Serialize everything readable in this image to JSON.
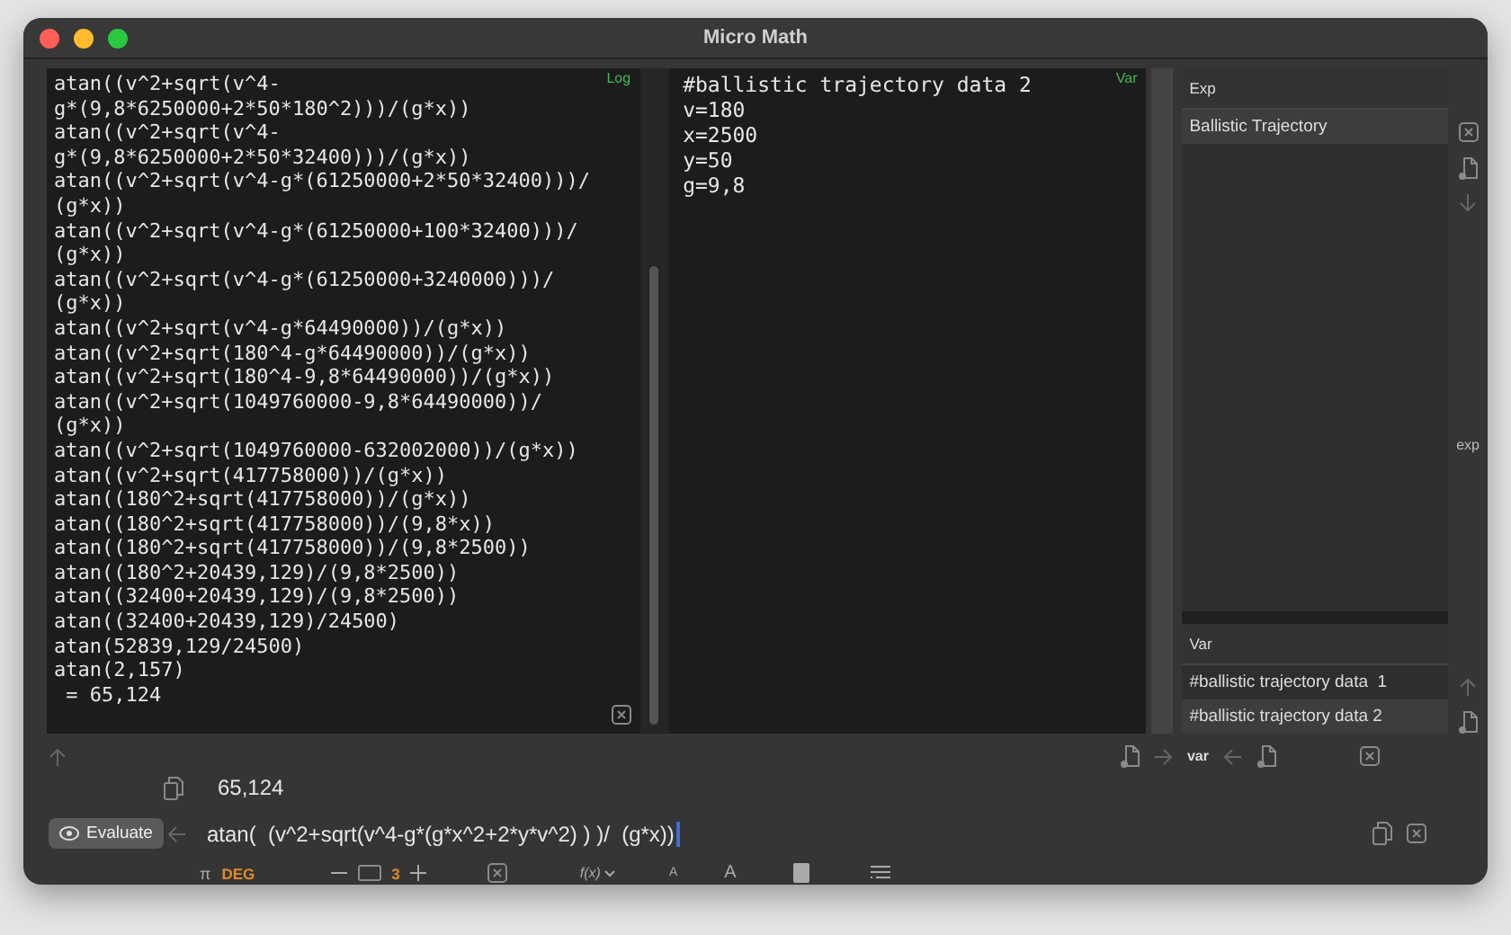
{
  "window": {
    "title": "Micro Math"
  },
  "log": {
    "badge": "Log",
    "lines": [
      "atan((v^2+sqrt(v^4-",
      "g*(9,8*6250000+2*50*180^2)))/(g*x))",
      "atan((v^2+sqrt(v^4-",
      "g*(9,8*6250000+2*50*32400)))/(g*x))",
      "atan((v^2+sqrt(v^4-g*(61250000+2*50*32400)))/",
      "(g*x))",
      "atan((v^2+sqrt(v^4-g*(61250000+100*32400)))/",
      "(g*x))",
      "atan((v^2+sqrt(v^4-g*(61250000+3240000)))/",
      "(g*x))",
      "atan((v^2+sqrt(v^4-g*64490000))/(g*x))",
      "atan((v^2+sqrt(180^4-g*64490000))/(g*x))",
      "atan((v^2+sqrt(180^4-9,8*64490000))/(g*x))",
      "atan((v^2+sqrt(1049760000-9,8*64490000))/",
      "(g*x))",
      "atan((v^2+sqrt(1049760000-632002000))/(g*x))",
      "atan((v^2+sqrt(417758000))/(g*x))",
      "atan((180^2+sqrt(417758000))/(g*x))",
      "atan((180^2+sqrt(417758000))/(9,8*x))",
      "atan((180^2+sqrt(417758000))/(9,8*2500))",
      "atan((180^2+20439,129)/(9,8*2500))",
      "atan((32400+20439,129)/(9,8*2500))",
      "atan((32400+20439,129)/24500)",
      "atan(52839,129/24500)",
      "atan(2,157)",
      " = 65,124"
    ]
  },
  "var_editor": {
    "badge": "Var",
    "lines": [
      "#ballistic trajectory data 2",
      "v=180",
      "x=2500",
      "y=50",
      "g=9,8"
    ]
  },
  "exp_list": {
    "header": "Exp",
    "items": [
      {
        "label": "Ballistic Trajectory",
        "selected": true
      }
    ]
  },
  "var_list": {
    "header": "Var",
    "items": [
      {
        "label": "#ballistic trajectory data  1",
        "selected": false
      },
      {
        "label": "#ballistic trajectory data 2",
        "selected": true
      }
    ]
  },
  "side_label": "exp",
  "transfer_label": "var",
  "result": "65,124",
  "evaluate_button": "Evaluate",
  "expression": "atan(  (v^2+sqrt(v^4-g*(g*x^2+2*y*v^2) ) )/  (g*x))",
  "toolbar": {
    "pi": "π",
    "angle_mode": "DEG",
    "precision": "3",
    "fx": "f(x)",
    "font_small": "A",
    "font_large": "A"
  }
}
